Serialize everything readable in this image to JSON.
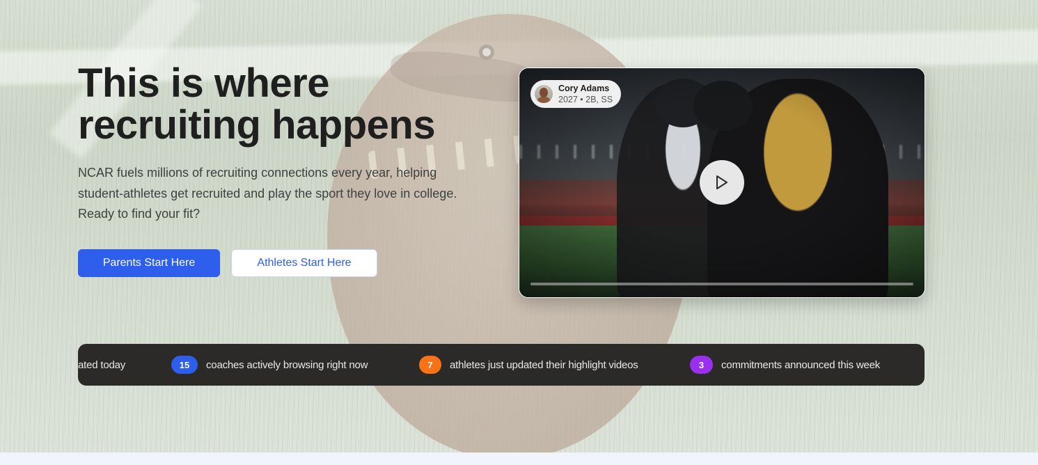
{
  "hero": {
    "title_line1": "This is where",
    "title_line2": "recruiting happens",
    "description": "NCAR fuels millions of recruiting connections every year, helping student-athletes get recruited and play the sport they love in college. Ready to find your fit?"
  },
  "cta": {
    "parents_label": "Parents Start Here",
    "athletes_label": "Athletes Start Here"
  },
  "video": {
    "athlete_name": "Cory Adams",
    "athlete_meta": "2027 • 2B, SS",
    "play_icon": "play-icon"
  },
  "ticker": {
    "items": [
      {
        "count": "",
        "text": "ated today"
      },
      {
        "count": "15",
        "text": "coaches actively browsing right now",
        "color": "#2d5fec"
      },
      {
        "count": "7",
        "text": "athletes just updated their highlight videos",
        "color": "#f97316"
      },
      {
        "count": "3",
        "text": "commitments announced this week",
        "color": "#9b2ff0"
      }
    ]
  },
  "colors": {
    "primary": "#2d5fec",
    "ticker_bg": "#2b2a28",
    "badge_blue": "#2d5fec",
    "badge_orange": "#f97316",
    "badge_purple": "#9b2ff0"
  }
}
